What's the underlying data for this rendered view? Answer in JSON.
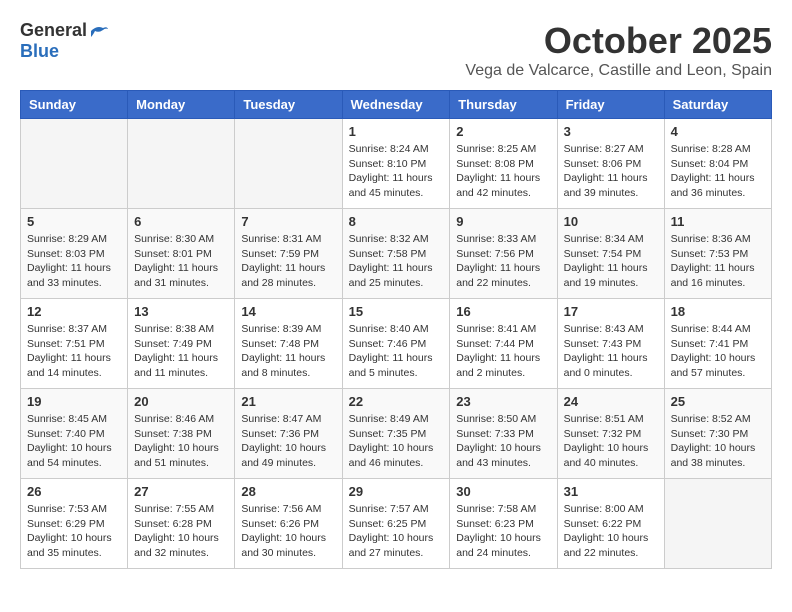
{
  "header": {
    "logo_general": "General",
    "logo_blue": "Blue",
    "month_title": "October 2025",
    "location": "Vega de Valcarce, Castille and Leon, Spain"
  },
  "days_of_week": [
    "Sunday",
    "Monday",
    "Tuesday",
    "Wednesday",
    "Thursday",
    "Friday",
    "Saturday"
  ],
  "weeks": [
    [
      {
        "day": "",
        "info": ""
      },
      {
        "day": "",
        "info": ""
      },
      {
        "day": "",
        "info": ""
      },
      {
        "day": "1",
        "info": "Sunrise: 8:24 AM\nSunset: 8:10 PM\nDaylight: 11 hours and 45 minutes."
      },
      {
        "day": "2",
        "info": "Sunrise: 8:25 AM\nSunset: 8:08 PM\nDaylight: 11 hours and 42 minutes."
      },
      {
        "day": "3",
        "info": "Sunrise: 8:27 AM\nSunset: 8:06 PM\nDaylight: 11 hours and 39 minutes."
      },
      {
        "day": "4",
        "info": "Sunrise: 8:28 AM\nSunset: 8:04 PM\nDaylight: 11 hours and 36 minutes."
      }
    ],
    [
      {
        "day": "5",
        "info": "Sunrise: 8:29 AM\nSunset: 8:03 PM\nDaylight: 11 hours and 33 minutes."
      },
      {
        "day": "6",
        "info": "Sunrise: 8:30 AM\nSunset: 8:01 PM\nDaylight: 11 hours and 31 minutes."
      },
      {
        "day": "7",
        "info": "Sunrise: 8:31 AM\nSunset: 7:59 PM\nDaylight: 11 hours and 28 minutes."
      },
      {
        "day": "8",
        "info": "Sunrise: 8:32 AM\nSunset: 7:58 PM\nDaylight: 11 hours and 25 minutes."
      },
      {
        "day": "9",
        "info": "Sunrise: 8:33 AM\nSunset: 7:56 PM\nDaylight: 11 hours and 22 minutes."
      },
      {
        "day": "10",
        "info": "Sunrise: 8:34 AM\nSunset: 7:54 PM\nDaylight: 11 hours and 19 minutes."
      },
      {
        "day": "11",
        "info": "Sunrise: 8:36 AM\nSunset: 7:53 PM\nDaylight: 11 hours and 16 minutes."
      }
    ],
    [
      {
        "day": "12",
        "info": "Sunrise: 8:37 AM\nSunset: 7:51 PM\nDaylight: 11 hours and 14 minutes."
      },
      {
        "day": "13",
        "info": "Sunrise: 8:38 AM\nSunset: 7:49 PM\nDaylight: 11 hours and 11 minutes."
      },
      {
        "day": "14",
        "info": "Sunrise: 8:39 AM\nSunset: 7:48 PM\nDaylight: 11 hours and 8 minutes."
      },
      {
        "day": "15",
        "info": "Sunrise: 8:40 AM\nSunset: 7:46 PM\nDaylight: 11 hours and 5 minutes."
      },
      {
        "day": "16",
        "info": "Sunrise: 8:41 AM\nSunset: 7:44 PM\nDaylight: 11 hours and 2 minutes."
      },
      {
        "day": "17",
        "info": "Sunrise: 8:43 AM\nSunset: 7:43 PM\nDaylight: 11 hours and 0 minutes."
      },
      {
        "day": "18",
        "info": "Sunrise: 8:44 AM\nSunset: 7:41 PM\nDaylight: 10 hours and 57 minutes."
      }
    ],
    [
      {
        "day": "19",
        "info": "Sunrise: 8:45 AM\nSunset: 7:40 PM\nDaylight: 10 hours and 54 minutes."
      },
      {
        "day": "20",
        "info": "Sunrise: 8:46 AM\nSunset: 7:38 PM\nDaylight: 10 hours and 51 minutes."
      },
      {
        "day": "21",
        "info": "Sunrise: 8:47 AM\nSunset: 7:36 PM\nDaylight: 10 hours and 49 minutes."
      },
      {
        "day": "22",
        "info": "Sunrise: 8:49 AM\nSunset: 7:35 PM\nDaylight: 10 hours and 46 minutes."
      },
      {
        "day": "23",
        "info": "Sunrise: 8:50 AM\nSunset: 7:33 PM\nDaylight: 10 hours and 43 minutes."
      },
      {
        "day": "24",
        "info": "Sunrise: 8:51 AM\nSunset: 7:32 PM\nDaylight: 10 hours and 40 minutes."
      },
      {
        "day": "25",
        "info": "Sunrise: 8:52 AM\nSunset: 7:30 PM\nDaylight: 10 hours and 38 minutes."
      }
    ],
    [
      {
        "day": "26",
        "info": "Sunrise: 7:53 AM\nSunset: 6:29 PM\nDaylight: 10 hours and 35 minutes."
      },
      {
        "day": "27",
        "info": "Sunrise: 7:55 AM\nSunset: 6:28 PM\nDaylight: 10 hours and 32 minutes."
      },
      {
        "day": "28",
        "info": "Sunrise: 7:56 AM\nSunset: 6:26 PM\nDaylight: 10 hours and 30 minutes."
      },
      {
        "day": "29",
        "info": "Sunrise: 7:57 AM\nSunset: 6:25 PM\nDaylight: 10 hours and 27 minutes."
      },
      {
        "day": "30",
        "info": "Sunrise: 7:58 AM\nSunset: 6:23 PM\nDaylight: 10 hours and 24 minutes."
      },
      {
        "day": "31",
        "info": "Sunrise: 8:00 AM\nSunset: 6:22 PM\nDaylight: 10 hours and 22 minutes."
      },
      {
        "day": "",
        "info": ""
      }
    ]
  ]
}
